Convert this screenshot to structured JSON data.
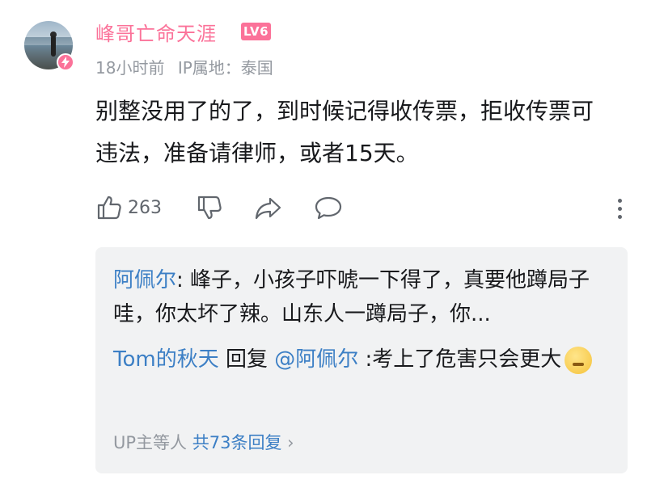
{
  "comment": {
    "author": "峰哥亡命天涯",
    "level": "LV6",
    "time": "18小时前",
    "ip_location": "IP属地：泰国",
    "text": "别整没用了的了，到时候记得收传票，拒收传票可违法，准备请律师，或者15天。",
    "likes": "263"
  },
  "replies": [
    {
      "user": "阿佩尔",
      "sep": ": ",
      "text": "峰子，小孩子吓唬一下得了，真要他蹲局子哇，你太坏了辣。山东人一蹲局子，你..."
    },
    {
      "user": "Tom的秋天",
      "mid": " 回复 ",
      "target": "@阿佩尔",
      "text": " :考上了危害只会更大"
    }
  ],
  "sub_summary": {
    "prefix": "UP主等人 ",
    "total": "共73条回复",
    "arrow": " ›"
  },
  "colors": {
    "accent": "#fb7299",
    "link": "#3c7fc5",
    "muted": "#9499a0",
    "panel": "#f1f2f3"
  }
}
